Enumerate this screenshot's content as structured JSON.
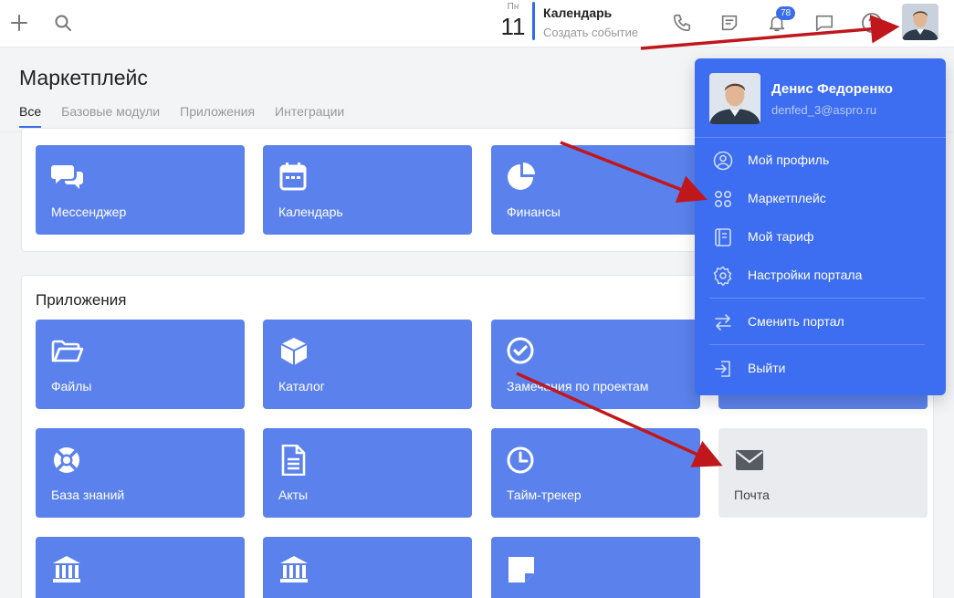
{
  "topbar": {
    "calendar": {
      "weekday": "Пн",
      "day": "11",
      "title": "Календарь",
      "subtitle": "Создать событие"
    },
    "notifications_count": "78",
    "icons": [
      "plus-icon",
      "search-icon",
      "phone-icon",
      "notes-icon",
      "bell-icon",
      "chat-icon",
      "help-icon"
    ]
  },
  "page": {
    "title": "Маркетплейс",
    "tabs": [
      {
        "label": "Все",
        "active": true
      },
      {
        "label": "Базовые модули",
        "active": false
      },
      {
        "label": "Приложения",
        "active": false
      },
      {
        "label": "Интеграции",
        "active": false
      }
    ]
  },
  "modules": {
    "tiles": [
      {
        "label": "Мессенджер",
        "icon": "chat-bubbles-icon"
      },
      {
        "label": "Календарь",
        "icon": "calendar-icon"
      },
      {
        "label": "Финансы",
        "icon": "pie-chart-icon"
      }
    ]
  },
  "apps": {
    "title": "Приложения",
    "tiles": [
      {
        "label": "Файлы",
        "icon": "folder-icon"
      },
      {
        "label": "Каталог",
        "icon": "box-icon"
      },
      {
        "label": "Замечания по проектам",
        "icon": "check-circle-icon"
      },
      {
        "label": "База знаний",
        "icon": "lifebuoy-icon"
      },
      {
        "label": "Акты",
        "icon": "document-icon"
      },
      {
        "label": "Тайм-трекер",
        "icon": "clock-icon"
      },
      {
        "label": "Почта",
        "icon": "mail-icon"
      },
      {
        "label": "",
        "icon": "bank-icon"
      },
      {
        "label": "",
        "icon": "bank-icon"
      },
      {
        "label": "",
        "icon": "sticky-note-icon"
      }
    ]
  },
  "profile_menu": {
    "name": "Денис Федоренко",
    "email": "denfed_3@aspro.ru",
    "items": [
      {
        "label": "Мой профиль",
        "icon": "user-circle-icon"
      },
      {
        "label": "Маркетплейс",
        "icon": "apps-grid-icon"
      },
      {
        "label": "Мой тариф",
        "icon": "tariff-icon"
      },
      {
        "label": "Настройки портала",
        "icon": "gear-icon"
      },
      {
        "label": "Сменить портал",
        "icon": "swap-icon"
      },
      {
        "label": "Выйти",
        "icon": "logout-icon"
      }
    ]
  },
  "colors": {
    "accent": "#3d6df0",
    "tile": "#5b82ec",
    "tile_disabled": "#e9ebef",
    "annotation_arrow": "#c0171c"
  }
}
